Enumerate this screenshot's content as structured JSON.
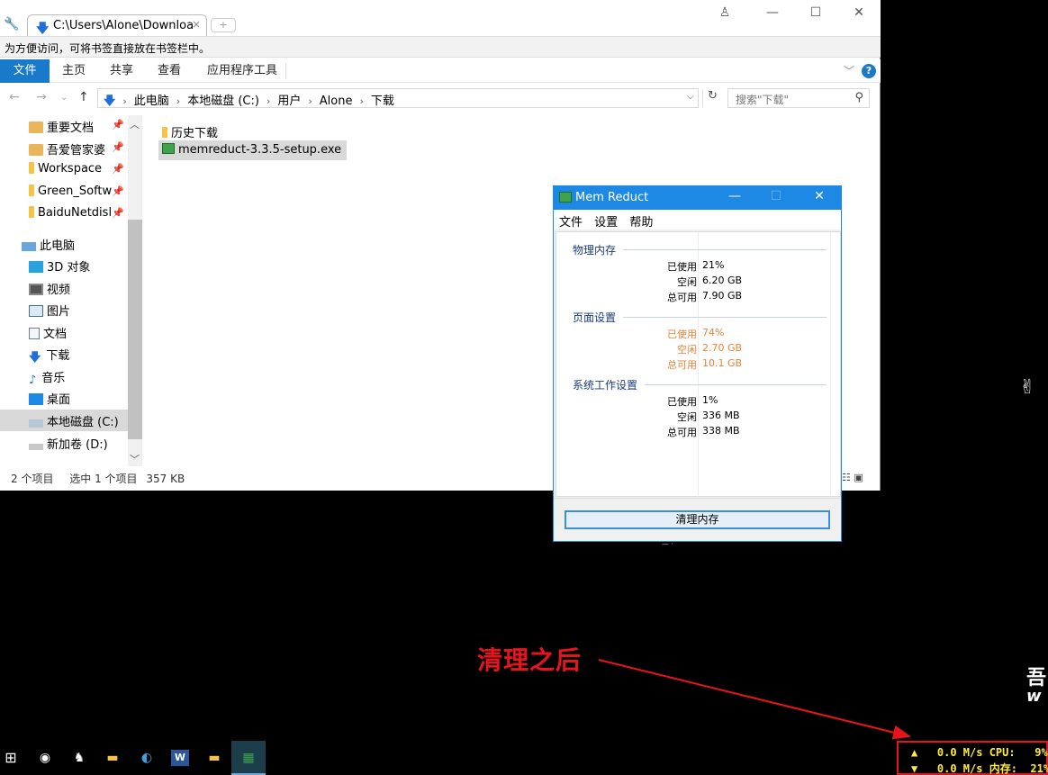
{
  "browser": {
    "tab_title": "C:\\Users\\Alone\\Downloa",
    "tab_close": "×",
    "new_tab": "+",
    "bookmark_hint": "为方便访问，可将书签直接放在书签栏中。"
  },
  "ribbon": {
    "file": "文件",
    "tabs": [
      "主页",
      "共享",
      "查看",
      "应用程序工具"
    ]
  },
  "address": {
    "crumbs": [
      "此电脑",
      "本地磁盘 (C:)",
      "用户",
      "Alone",
      "下载"
    ],
    "search_placeholder": "搜索\"下载\""
  },
  "nav_pane": {
    "items": [
      {
        "label": "重要文档",
        "icon": "folder-icon",
        "pinned": true
      },
      {
        "label": "吾爱管家婆",
        "icon": "folder-icon",
        "pinned": true
      },
      {
        "label": "Workspace",
        "icon": "folder-icon",
        "pinned": true
      },
      {
        "label": "Green_Softw",
        "icon": "folder-icon",
        "pinned": true
      },
      {
        "label": "BaiduNetdisl",
        "icon": "folder-icon",
        "pinned": true
      },
      {
        "label": "此电脑",
        "icon": "computer-icon"
      },
      {
        "label": "3D 对象",
        "icon": "3d-objects-icon"
      },
      {
        "label": "视频",
        "icon": "video-icon"
      },
      {
        "label": "图片",
        "icon": "pictures-icon"
      },
      {
        "label": "文档",
        "icon": "documents-icon"
      },
      {
        "label": "下载",
        "icon": "downloads-icon"
      },
      {
        "label": "音乐",
        "icon": "music-icon"
      },
      {
        "label": "桌面",
        "icon": "desktop-icon"
      },
      {
        "label": "本地磁盘 (C:)",
        "icon": "drive-icon",
        "selected": true
      },
      {
        "label": "新加卷 (D:)",
        "icon": "drive-icon"
      }
    ]
  },
  "files": [
    {
      "name": "历史下载",
      "icon": "folder-icon"
    },
    {
      "name": "memreduct-3.3.5-setup.exe",
      "icon": "installer-icon",
      "selected": true
    }
  ],
  "status": {
    "count": "2 个项目",
    "selection": "选中 1 个项目",
    "size": "357 KB"
  },
  "memreduct": {
    "title": "Mem Reduct",
    "menu": [
      "文件",
      "设置",
      "帮助"
    ],
    "groups": [
      {
        "name": "物理内存",
        "rows": [
          {
            "label": "已使用",
            "value": "21%"
          },
          {
            "label": "空闲",
            "value": "6.20 GB"
          },
          {
            "label": "总可用",
            "value": "7.90 GB"
          }
        ]
      },
      {
        "name": "页面设置",
        "rows": [
          {
            "label": "已使用",
            "value": "74%"
          },
          {
            "label": "空闲",
            "value": "2.70 GB"
          },
          {
            "label": "总可用",
            "value": "10.1 GB"
          }
        ]
      },
      {
        "name": "系统工作设置",
        "rows": [
          {
            "label": "已使用",
            "value": "1%"
          },
          {
            "label": "空闲",
            "value": "336 MB"
          },
          {
            "label": "总可用",
            "value": "338 MB"
          }
        ]
      }
    ],
    "clean_button": "清理内存",
    "warning_color": "#e8833a"
  },
  "annotation": {
    "text": "清理之后",
    "color": "#e8141c"
  },
  "netmon": {
    "up": "▲   0.0 M/s CPU:   9%",
    "down": "▼   0.0 M/s 内存:  21%"
  },
  "desktop_text": {
    "right_a": "吾",
    "right_b": "w"
  }
}
